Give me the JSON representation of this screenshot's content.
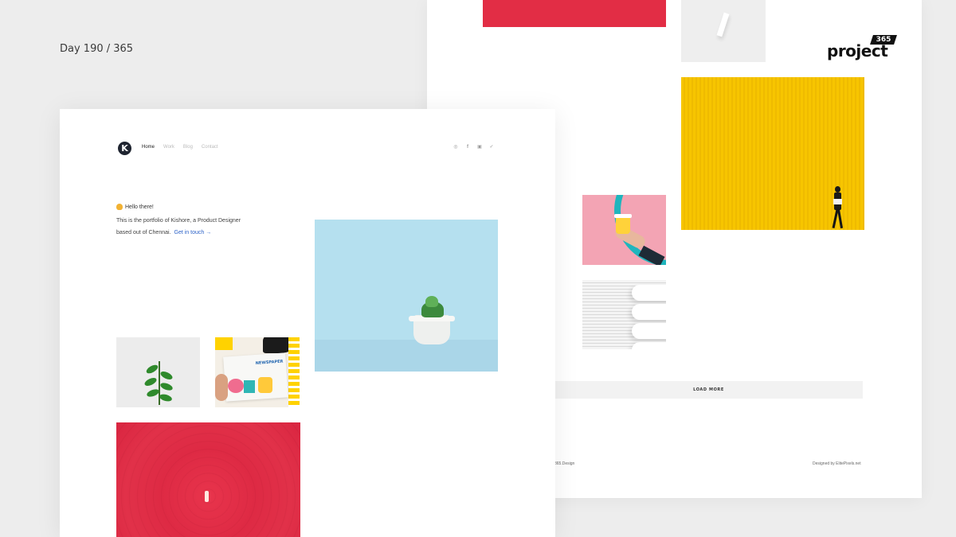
{
  "day_label": "Day 190 / 365",
  "brand": {
    "word": "project",
    "tag": "365"
  },
  "back_page": {
    "load_more_label": "LOAD MORE",
    "footer_left": "365.Design",
    "footer_right": "Designed by ElitePixels.net"
  },
  "front_page": {
    "logo_letter": "K",
    "nav": [
      {
        "label": "Home",
        "active": true
      },
      {
        "label": "Work",
        "active": false
      },
      {
        "label": "Blog",
        "active": false
      },
      {
        "label": "Contact",
        "active": false
      }
    ],
    "social_icons": [
      "dribbble-icon",
      "facebook-icon",
      "instagram-icon",
      "twitter-icon"
    ],
    "greeting": "Hello there!",
    "intro_line1": "This is the portfolio of Kishore, a Product Designer",
    "intro_line2": "based out of Chennai.",
    "cta_label": "Get in touch →"
  },
  "newspaper_headline": "NEWSPAPER",
  "colors": {
    "background": "#ededed",
    "accent_red": "#e22d45",
    "accent_yellow": "#f7c500",
    "link_blue": "#2d63c8"
  }
}
